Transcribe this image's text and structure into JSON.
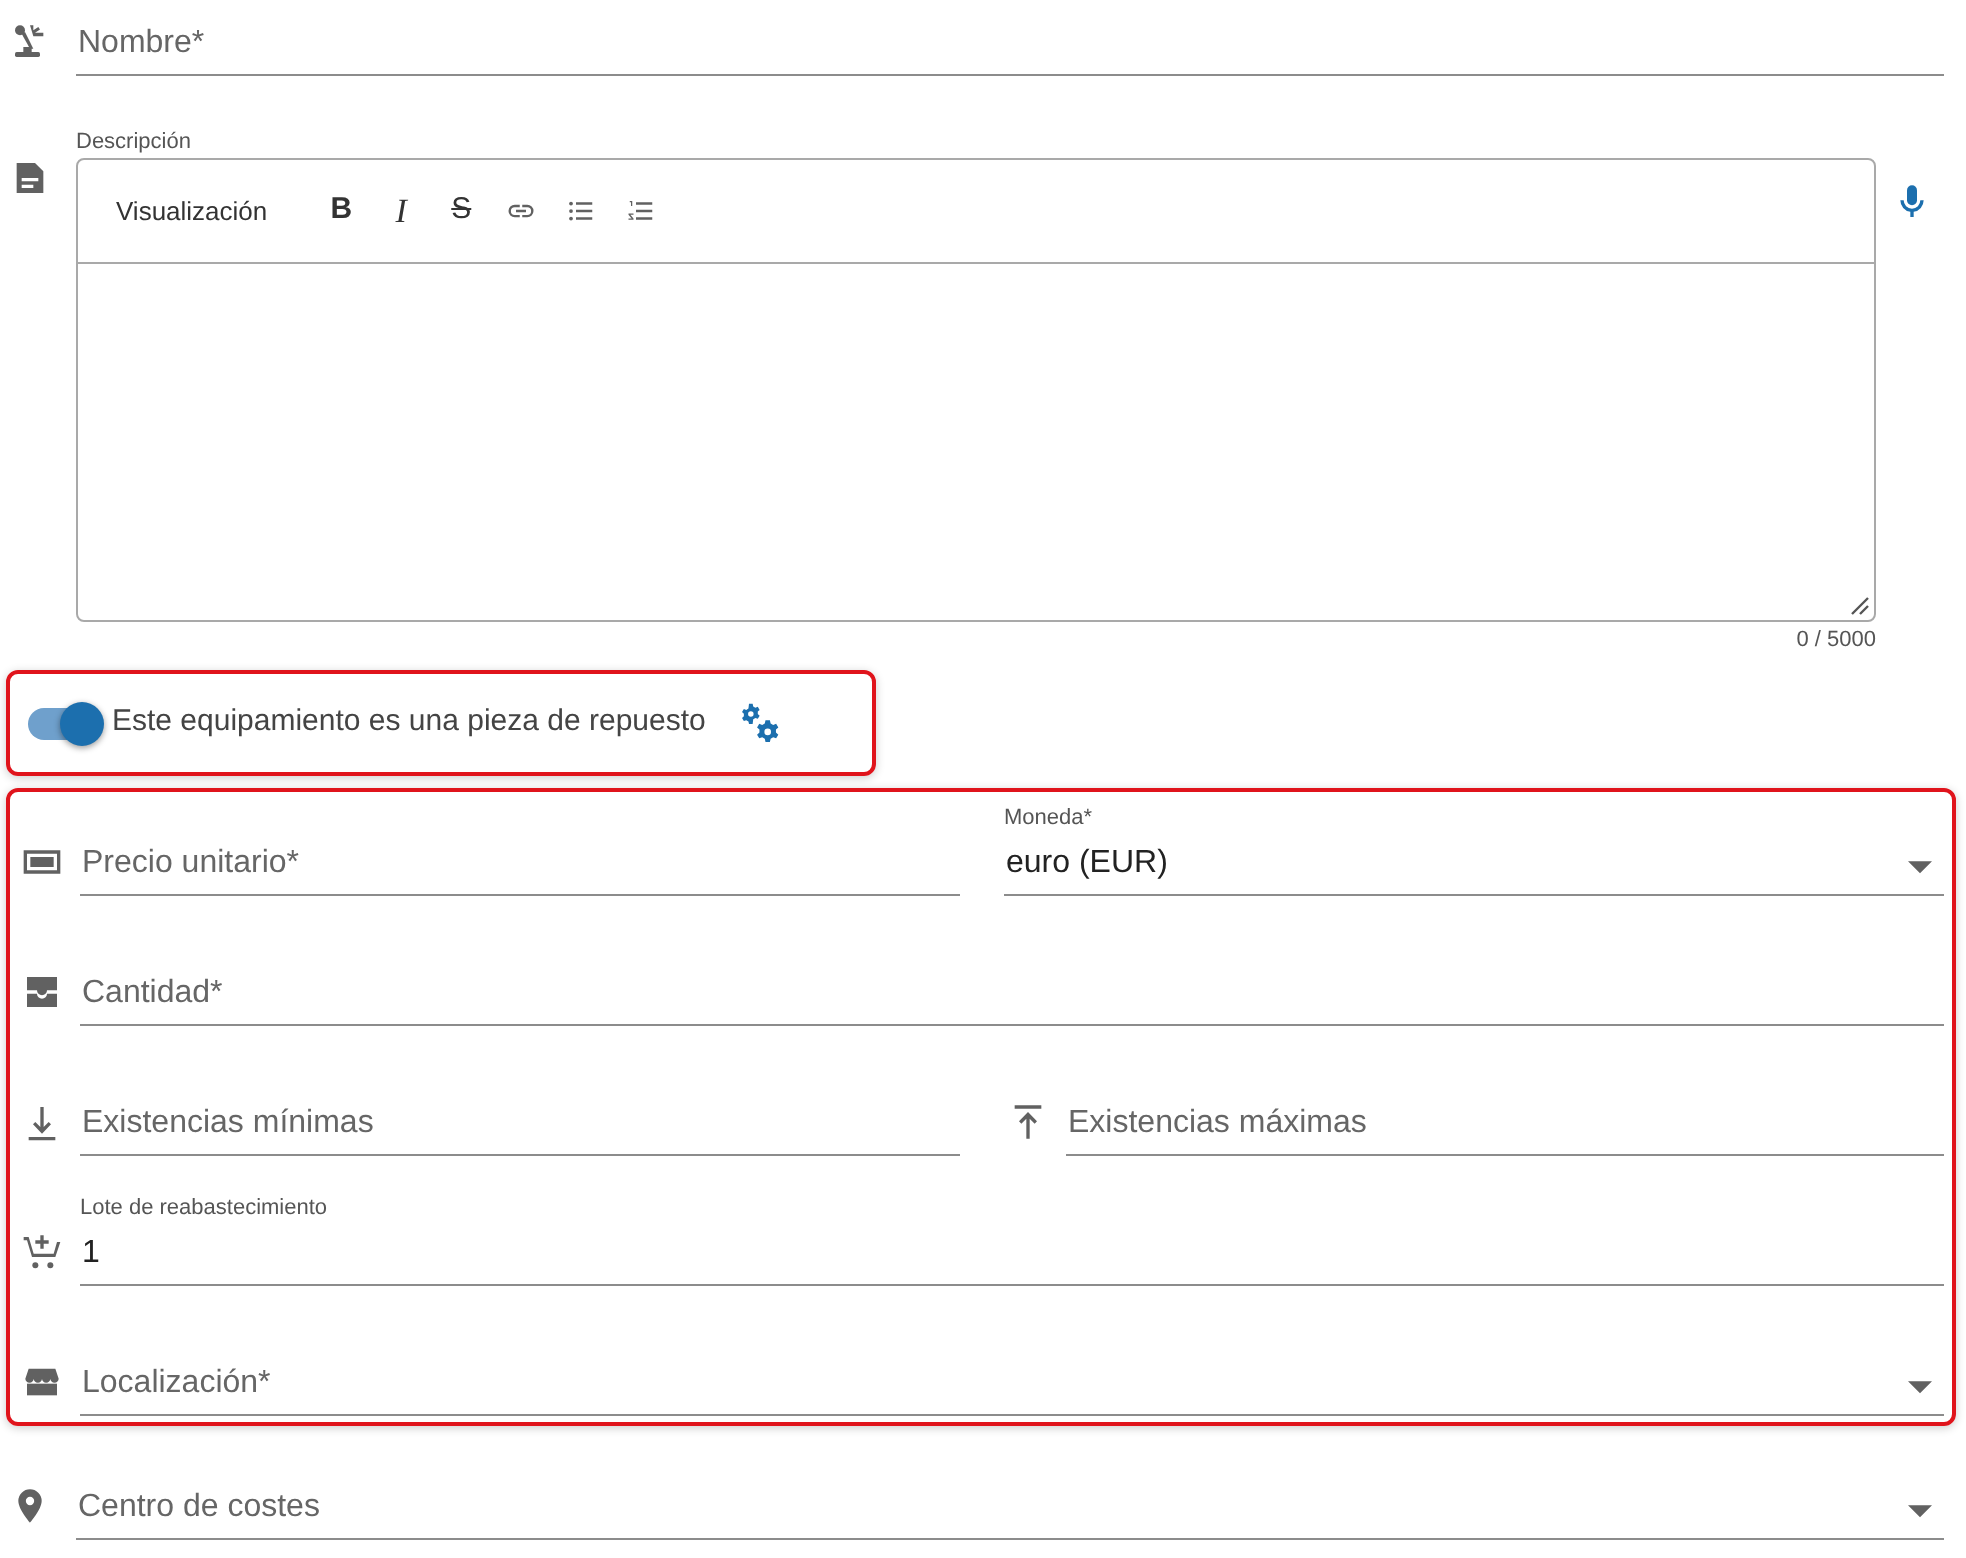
{
  "name_field": {
    "placeholder": "Nombre*"
  },
  "description": {
    "label": "Descripción",
    "counter": "0 / 5000",
    "toolbar": [
      {
        "kind": "mode",
        "label": "Visualización"
      },
      {
        "kind": "bold",
        "label": "B"
      },
      {
        "kind": "italic",
        "label": "I"
      },
      {
        "kind": "strike",
        "label": "S"
      },
      {
        "kind": "link"
      },
      {
        "kind": "bullets"
      },
      {
        "kind": "numbered"
      }
    ]
  },
  "spare_part": {
    "label": "Este equipamiento es una pieza de repuesto",
    "on": true
  },
  "stock_rows": [
    {
      "fields": [
        {
          "kind": "text",
          "placeholder": "Precio unitario*"
        },
        {
          "kind": "select",
          "label": "Moneda*",
          "value": "euro (EUR)"
        }
      ]
    },
    {
      "fields": [
        {
          "kind": "text",
          "placeholder": "Cantidad*"
        }
      ]
    },
    {
      "fields": [
        {
          "kind": "text",
          "placeholder": "Existencias mínimas"
        },
        {
          "kind": "text",
          "placeholder": "Existencias máximas"
        }
      ]
    },
    {
      "fields": [
        {
          "kind": "text",
          "label": "Lote de reabastecimiento",
          "value": "1"
        }
      ]
    },
    {
      "fields": [
        {
          "kind": "select",
          "placeholder": "Localización*"
        }
      ]
    }
  ],
  "cost_center": {
    "kind": "select",
    "placeholder": "Centro de costes"
  }
}
